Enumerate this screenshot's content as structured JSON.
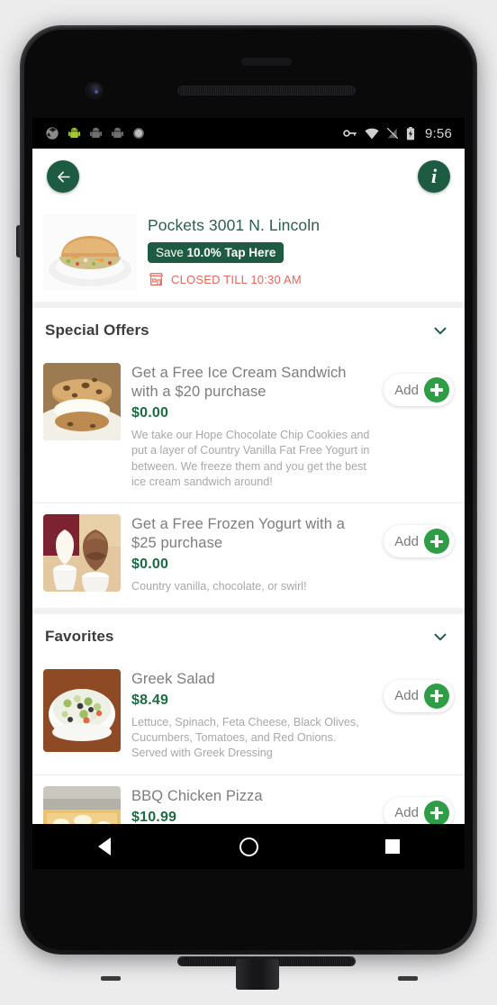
{
  "status_bar": {
    "time": "9:56",
    "left_icons": [
      "sync-swirl-icon",
      "android-green-icon",
      "android-gray-icon",
      "android-gray-icon-2",
      "circle-gray-icon"
    ],
    "right_icons": [
      "vpn-key-icon",
      "wifi-icon",
      "signal-off-icon",
      "battery-charging-icon"
    ]
  },
  "app_bar": {
    "back_label": "back",
    "info_label": "i"
  },
  "restaurant": {
    "name": "Pockets 3001 N. Lincoln",
    "save_prefix": "Save ",
    "save_amount": "10.0% Tap Here",
    "status": "CLOSED TILL 10:30 AM",
    "thumb": "sandwich-plate-image"
  },
  "sections": [
    {
      "title": "Special Offers",
      "expanded": true,
      "items": [
        {
          "name": "Get a Free Ice Cream Sandwich with a $20 purchase",
          "price": "$0.00",
          "description": "We take our Hope Chocolate Chip Cookies and put a layer of Country Vanilla Fat Free Yogurt in between. We freeze them and you get the best ice cream sandwich around!",
          "add_label": "Add",
          "thumb": "ice-cream-sandwich-image"
        },
        {
          "name": "Get a Free Frozen Yogurt with a $25 purchase",
          "price": "$0.00",
          "description": "Country vanilla, chocolate, or swirl!",
          "add_label": "Add",
          "thumb": "frozen-yogurt-image"
        }
      ]
    },
    {
      "title": "Favorites",
      "expanded": true,
      "items": [
        {
          "name": "Greek Salad",
          "price": "$8.49",
          "description": "Lettuce, Spinach, Feta Cheese, Black Olives, Cucumbers, Tomatoes, and Red Onions. Served with Greek Dressing",
          "add_label": "Add",
          "thumb": "greek-salad-image"
        },
        {
          "name": "BBQ Chicken Pizza",
          "price": "$10.99",
          "description": "",
          "add_label": "Add",
          "thumb": "bbq-chicken-pizza-image"
        }
      ]
    }
  ],
  "nav_bar": {
    "back": "back-triangle",
    "home": "home-circle",
    "recents": "recents-square"
  },
  "colors": {
    "brand_green": "#1d5c42",
    "price_green": "#1d6b43",
    "add_green": "#2e9d46",
    "closed_red": "#e2675c",
    "title_green": "#2c5e4a"
  }
}
